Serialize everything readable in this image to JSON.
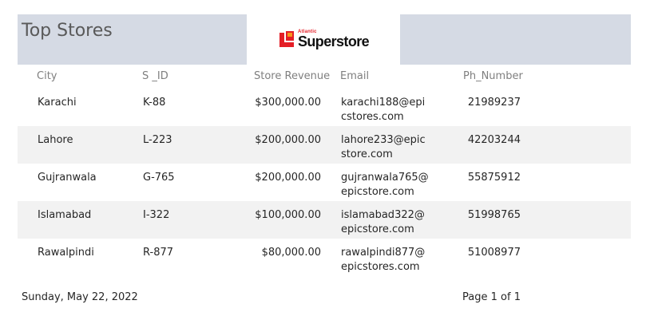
{
  "report": {
    "title": "Top Stores",
    "logo": {
      "small_text": "Atlantic",
      "big_text": "Superstore",
      "icon": "superstore-logo-icon",
      "brand_color": "#e41e26"
    },
    "header_bg": "#d5dae4",
    "columns": {
      "city": "City",
      "s_id": "S _ID",
      "revenue": "Store Revenue",
      "email": "Email",
      "phone": "Ph_Number"
    },
    "rows": [
      {
        "city": "Karachi",
        "s_id": "K-88",
        "revenue": "$300,000.00",
        "email": "karachi188@epicstores.com",
        "phone": "21989237"
      },
      {
        "city": "Lahore",
        "s_id": "L-223",
        "revenue": "$200,000.00",
        "email": "lahore233@epicstore.com",
        "phone": "42203244"
      },
      {
        "city": "Gujranwala",
        "s_id": "G-765",
        "revenue": "$200,000.00",
        "email": "gujranwala765@epicstore.com",
        "phone": "55875912"
      },
      {
        "city": "Islamabad",
        "s_id": "I-322",
        "revenue": "$100,000.00",
        "email": "islamabad322@epicstore.com",
        "phone": "51998765"
      },
      {
        "city": "Rawalpindi",
        "s_id": "R-877",
        "revenue": "$80,000.00",
        "email": "rawalpindi877@epicstores.com",
        "phone": "51008977"
      }
    ],
    "footer": {
      "date": "Sunday, May 22, 2022",
      "page": "Page 1 of 1"
    }
  }
}
